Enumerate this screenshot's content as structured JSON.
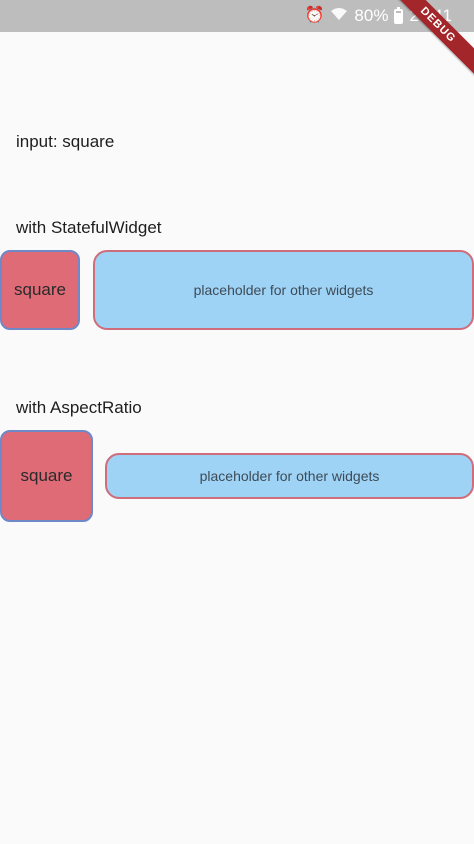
{
  "status_bar": {
    "battery_percent": "80%",
    "time": "23:41",
    "icons": [
      "alarm-icon",
      "wifi-icon",
      "battery-icon"
    ]
  },
  "debug_banner": "DEBUG",
  "input_label": "input: square",
  "section_stateful": {
    "title": "with StatefulWidget",
    "square_label": "square",
    "placeholder_label": "placeholder for other widgets"
  },
  "section_aspect": {
    "title": "with AspectRatio",
    "square_label": "square",
    "placeholder_label": "placeholder for other widgets"
  },
  "colors": {
    "square_fill": "#df6b77",
    "square_border": "#6f88c8",
    "placeholder_fill": "#9fd3f5",
    "placeholder_border": "#cf6d7a",
    "debug_ribbon": "#a3262a"
  }
}
